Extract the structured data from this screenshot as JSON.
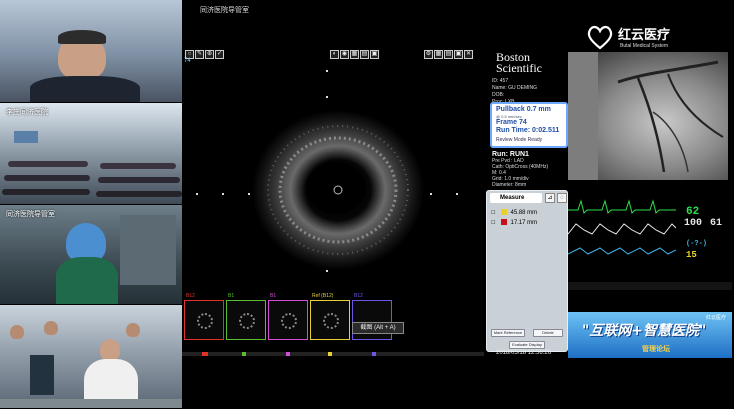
{
  "video_tiles": [
    {
      "label": ""
    },
    {
      "label": "李庄同济医院"
    },
    {
      "label": "同济医院导管室"
    },
    {
      "label": ""
    }
  ],
  "center": {
    "title": "同济医院导管室",
    "frame_tag": "74",
    "thumbs": [
      {
        "label": "B12",
        "color": "#e0332b"
      },
      {
        "label": "B1",
        "color": "#58c02f"
      },
      {
        "label": "B1",
        "color": "#d34fd8"
      },
      {
        "label": "Ref (B12)",
        "color": "#e6d13a"
      },
      {
        "label": "B12",
        "color": "#6f55e6"
      }
    ],
    "hint": "截图 (Alt + A)"
  },
  "bsci": {
    "brand_line1": "Boston",
    "brand_line2": "Scientific",
    "patient": [
      "ID: 457",
      "Name: GU DEMING",
      "DOB:",
      "Proc: LXB"
    ],
    "pullback_label": "Pullback 0.7 mm",
    "pullback_sub": "@ 0.5 mm/sec",
    "frame_label": "Frame 74",
    "runtime_label": "Run Time: 0:02.511",
    "mode": "Review Mode Ready",
    "run": "Run: RUN1",
    "run_details": [
      "Pre Pvd : LAD",
      "Cath: OptiCross (40MHz)",
      "M: 0.4",
      "Grid: 1.0 mm/div",
      "Diameter: 8mm"
    ],
    "measure_title": "Measure",
    "measurements": [
      {
        "value": "45.88 mm",
        "color": "#e8d22a"
      },
      {
        "value": "17.17 mm",
        "color": "#c8101a"
      }
    ],
    "btn_mark": "Mark Reference",
    "btn_delete": "Delete",
    "btn_display": "Evaluate Display",
    "datetime": "2018/05/18 12:56:26"
  },
  "logo": {
    "name": "红云医疗",
    "sub": "Butal Medical System"
  },
  "vitals": {
    "hr": "62",
    "bp_sys": "100",
    "bp_dia": "61",
    "extra": "(-?-)",
    "spo2": "15"
  },
  "banner": {
    "line1": "\"互联网+智慧医院\"",
    "line2": "管理论坛",
    "corner": "红云医疗"
  }
}
